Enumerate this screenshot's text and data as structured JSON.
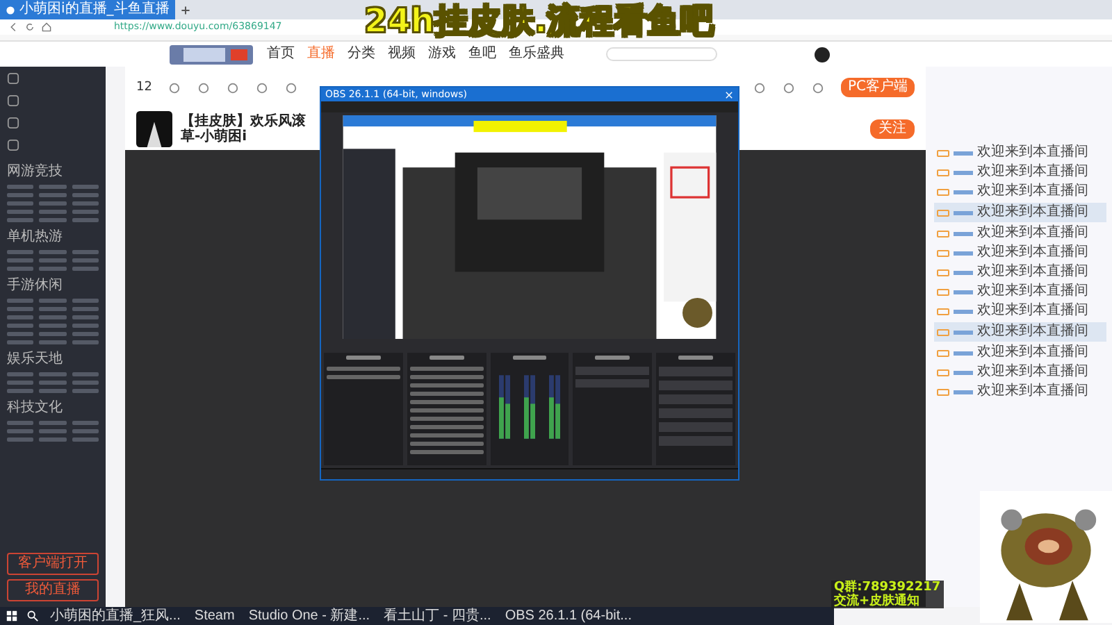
{
  "browser": {
    "tab_title": "小萌困i的直播_斗鱼直播",
    "url": "https://www.douyu.com/63869147"
  },
  "site_nav": [
    {
      "label": "首页",
      "selected": false
    },
    {
      "label": "直播",
      "selected": true
    },
    {
      "label": "分类",
      "selected": false
    },
    {
      "label": "视频",
      "selected": false
    },
    {
      "label": "游戏",
      "selected": false
    },
    {
      "label": "鱼吧",
      "selected": false
    },
    {
      "label": "鱼乐盛典",
      "selected": false
    }
  ],
  "sidebar": {
    "sections": [
      "网游竞技",
      "单机热游",
      "手游休闲",
      "娱乐天地",
      "科技文化"
    ],
    "buttons": [
      "客户端打开",
      "我的直播"
    ]
  },
  "toolbar": {
    "count": "12",
    "client_button": "PC客户端"
  },
  "stream": {
    "title": "【挂皮肤】欢乐风滚草-小萌困i",
    "follow": "关注"
  },
  "chat": {
    "messages": [
      {
        "text": "欢迎来到本直播间",
        "highlight": false
      },
      {
        "text": "欢迎来到本直播间",
        "highlight": false
      },
      {
        "text": "欢迎来到本直播间",
        "highlight": false
      },
      {
        "text": "欢迎来到本直播间",
        "highlight": true
      },
      {
        "text": "欢迎来到本直播间",
        "highlight": false
      },
      {
        "text": "欢迎来到本直播间",
        "highlight": false
      },
      {
        "text": "欢迎来到本直播间",
        "highlight": false
      },
      {
        "text": "欢迎来到本直播间",
        "highlight": false
      },
      {
        "text": "欢迎来到本直播间",
        "highlight": false
      },
      {
        "text": "欢迎来到本直播间",
        "highlight": true
      },
      {
        "text": "欢迎来到本直播间",
        "highlight": false
      },
      {
        "text": "欢迎来到本直播间",
        "highlight": false
      },
      {
        "text": "欢迎来到本直播间",
        "highlight": false
      }
    ]
  },
  "obs": {
    "title": "OBS 26.1.1 (64-bit, windows)"
  },
  "overlay": {
    "title": "24h挂皮肤.流程看鱼吧",
    "qq_group": "Q群:789392217",
    "notice": "交流+皮肤通知"
  },
  "taskbar": [
    "小萌困的直播_狂风...",
    "Steam",
    "Studio One - 新建...",
    "看土山丁 - 四贵...",
    "OBS 26.1.1 (64-bit..."
  ]
}
